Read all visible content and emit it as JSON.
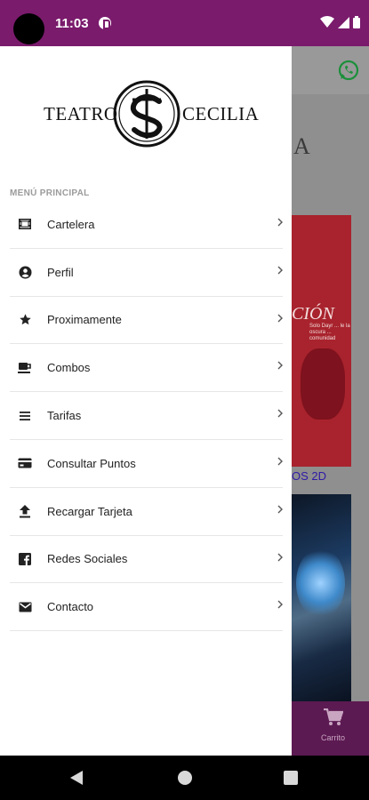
{
  "status_bar": {
    "time": "11:03"
  },
  "background_app": {
    "partial_heading": "A",
    "poster_title": "CIÓN",
    "poster_subtitle": "Solo Dayr ... le la oscura ... comunidad",
    "poster_label": "OS 2D",
    "cart_label": "Carrito"
  },
  "drawer": {
    "logo_left": "TEATRO",
    "logo_right": "CECILIA",
    "section_title": "MENÚ PRINCIPAL",
    "items": [
      {
        "label": "Cartelera",
        "icon": "film-icon"
      },
      {
        "label": "Perfil",
        "icon": "account-circle-icon"
      },
      {
        "label": "Proximamente",
        "icon": "star-icon"
      },
      {
        "label": "Combos",
        "icon": "coffee-cup-icon"
      },
      {
        "label": "Tarifas",
        "icon": "list-icon"
      },
      {
        "label": "Consultar Puntos",
        "icon": "credit-card-icon"
      },
      {
        "label": "Recargar Tarjeta",
        "icon": "upload-icon"
      },
      {
        "label": "Redes Sociales",
        "icon": "facebook-icon"
      },
      {
        "label": "Contacto",
        "icon": "mail-icon"
      }
    ]
  },
  "colors": {
    "status_bar": "#7a1b6c",
    "drawer_bg": "#ffffff",
    "icon": "#222222"
  }
}
